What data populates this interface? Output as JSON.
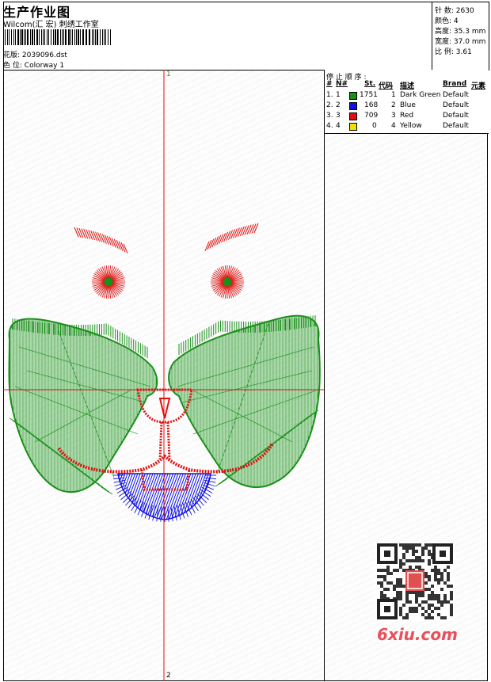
{
  "header": {
    "title": "生产作业图",
    "company": "Wilcom(汇 宏) 刺绣工作室",
    "design_label": "花版:",
    "design_value": "2039096.dst",
    "colorway_label": "色 位:",
    "colorway_value": "Colorway 1"
  },
  "stats": [
    {
      "label": "针 数:",
      "value": "2630"
    },
    {
      "label": "颜色:",
      "value": "4"
    },
    {
      "label": "高度:",
      "value": "35.3 mm"
    },
    {
      "label": "宽度:",
      "value": "37.0 mm"
    },
    {
      "label": "比 例:",
      "value": "3.61"
    }
  ],
  "legend": {
    "heading": "停 止 顺 序 :",
    "columns": [
      "#",
      "N#",
      "St.",
      "代码",
      "描述",
      "Brand",
      "元素"
    ],
    "rows": [
      {
        "num": "1.",
        "n": "1",
        "color": "#1a8f1a",
        "stitches": "1751",
        "code": "1",
        "desc": "Dark Green",
        "brand": "Default"
      },
      {
        "num": "2.",
        "n": "2",
        "color": "#1010e0",
        "stitches": "168",
        "code": "2",
        "desc": "Blue",
        "brand": "Default"
      },
      {
        "num": "3.",
        "n": "3",
        "color": "#e01010",
        "stitches": "709",
        "code": "3",
        "desc": "Red",
        "brand": "Default"
      },
      {
        "num": "4.",
        "n": "4",
        "color": "#f0e000",
        "stitches": "0",
        "code": "4",
        "desc": "Yellow",
        "brand": "Default"
      }
    ]
  },
  "axis": {
    "top_marker": "1",
    "bottom_marker": "2"
  },
  "watermark": {
    "site": "6xiu.com"
  }
}
